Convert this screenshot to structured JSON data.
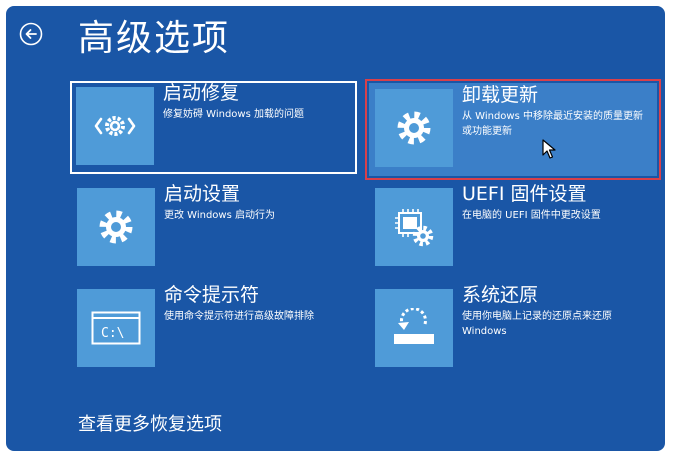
{
  "header": {
    "title": "高级选项",
    "back_icon": "back-arrow-circle-icon"
  },
  "options": [
    {
      "id": "startup-repair",
      "label": "启动修复",
      "description": "修复妨碍 Windows 加载的问题",
      "icon": "code-gear-icon",
      "state": "focused"
    },
    {
      "id": "uninstall-updates",
      "label": "卸载更新",
      "description": "从 Windows 中移除最近安装的质量更新或功能更新",
      "icon": "gear-icon",
      "state": "hover"
    },
    {
      "id": "startup-settings",
      "label": "启动设置",
      "description": "更改 Windows 启动行为",
      "icon": "gear-icon",
      "state": "normal"
    },
    {
      "id": "uefi-firmware",
      "label": "UEFI 固件设置",
      "description": "在电脑的 UEFI 固件中更改设置",
      "icon": "chip-gear-icon",
      "state": "normal"
    },
    {
      "id": "command-prompt",
      "label": "命令提示符",
      "description": "使用命令提示符进行高级故障排除",
      "icon": "console-icon",
      "state": "normal"
    },
    {
      "id": "system-restore",
      "label": "系统还原",
      "description": "使用你电脑上记录的还原点来还原 Windows",
      "icon": "restore-icon",
      "state": "normal"
    }
  ],
  "footer": {
    "more_options": "查看更多恢复选项"
  },
  "console_glyph": "C:\\",
  "colors": {
    "background": "#1a56a6",
    "tile_icon": "#4f9bd8",
    "hover_tile": "#3b7fc8",
    "hover_outline": "#d9404a",
    "text": "#ffffff"
  }
}
